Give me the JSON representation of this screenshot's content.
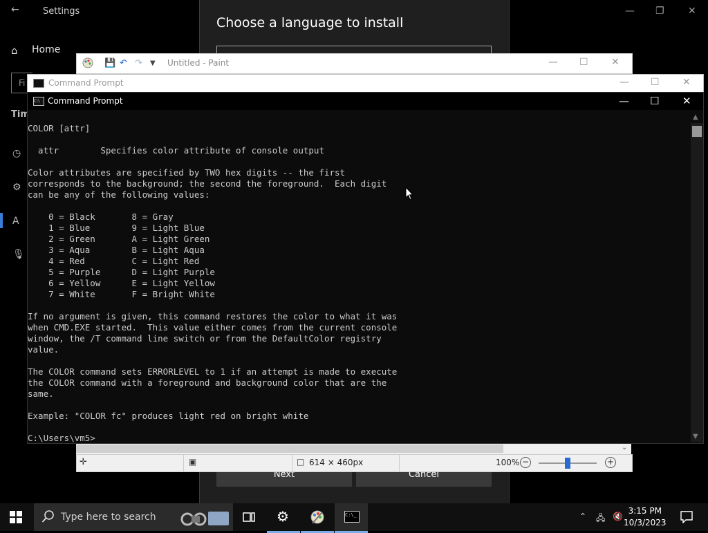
{
  "settings": {
    "title": "Settings",
    "home_label": "Home",
    "search_prefix": "Fi",
    "section_prefix": "Tim"
  },
  "language_dialog": {
    "title": "Choose a language to install",
    "next_label": "Next",
    "cancel_label": "Cancel"
  },
  "paint": {
    "title": "Untitled - Paint",
    "canvas_size": "614 × 460px",
    "zoom": "100%",
    "zoom_level": 0.5
  },
  "cmd_back": {
    "title": "Command Prompt"
  },
  "cmd": {
    "title": "Command Prompt",
    "output": [
      "COLOR [attr]",
      "",
      "  attr        Specifies color attribute of console output",
      "",
      "Color attributes are specified by TWO hex digits -- the first",
      "corresponds to the background; the second the foreground.  Each digit",
      "can be any of the following values:",
      "",
      "    0 = Black       8 = Gray",
      "    1 = Blue        9 = Light Blue",
      "    2 = Green       A = Light Green",
      "    3 = Aqua        B = Light Aqua",
      "    4 = Red         C = Light Red",
      "    5 = Purple      D = Light Purple",
      "    6 = Yellow      E = Light Yellow",
      "    7 = White       F = Bright White",
      "",
      "If no argument is given, this command restores the color to what it was",
      "when CMD.EXE started.  This value either comes from the current console",
      "window, the /T command line switch or from the DefaultColor registry",
      "value.",
      "",
      "The COLOR command sets ERRORLEVEL to 1 if an attempt is made to execute",
      "the COLOR command with a foreground and background color that are the",
      "same.",
      "",
      "Example: \"COLOR fc\" produces light red on bright white",
      "",
      "C:\\Users\\vm5>"
    ]
  },
  "taskbar": {
    "search_placeholder": "Type here to search",
    "time": "3:15 PM",
    "date": "10/3/2023"
  },
  "colors": {
    "accent": "#7aaeea",
    "console_bg": "#0c0c0c",
    "console_fg": "#cccccc"
  }
}
